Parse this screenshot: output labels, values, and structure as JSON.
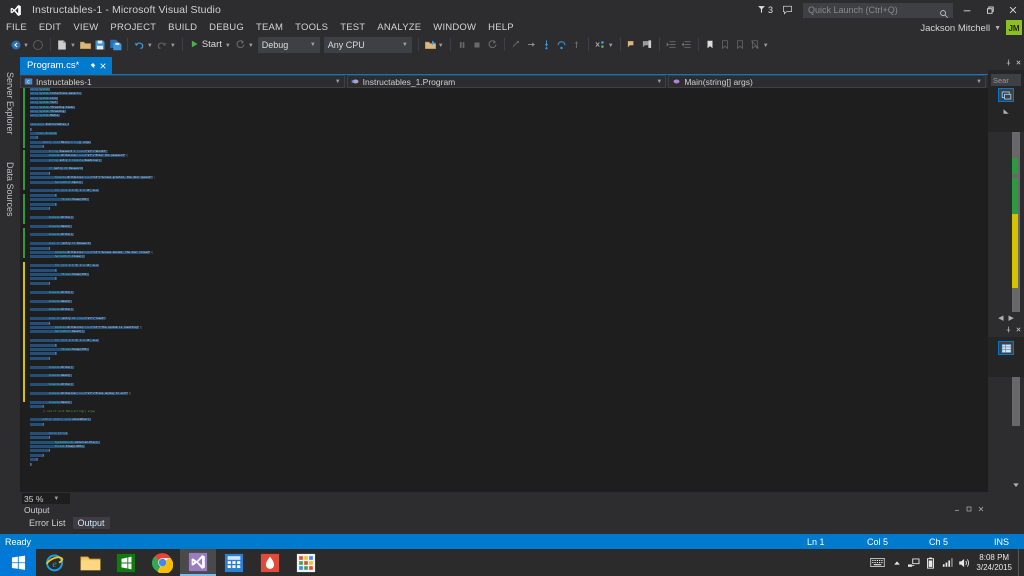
{
  "window": {
    "title": "Instructables-1 - Microsoft Visual Studio",
    "logo_icon": "visual-studio-logo",
    "minimize_icon": "minimize-icon",
    "restore_icon": "restore-icon",
    "close_icon": "close-icon"
  },
  "titlebar": {
    "notification_icon": "notification-flag-icon",
    "notification_count": "3",
    "feedback_icon": "feedback-smiley-icon",
    "quick_launch_placeholder": "Quick Launch (Ctrl+Q)",
    "quick_launch_value": "",
    "search_icon": "search-magnifier-icon"
  },
  "menu": {
    "items": [
      "FILE",
      "EDIT",
      "VIEW",
      "PROJECT",
      "BUILD",
      "DEBUG",
      "TEAM",
      "TOOLS",
      "TEST",
      "ANALYZE",
      "WINDOW",
      "HELP"
    ]
  },
  "account": {
    "user_name": "Jackson Mitchell",
    "avatar_initials": "JM",
    "caret_icon": "chevron-down-icon"
  },
  "toolbar": {
    "navigate_back_icon": "navigate-back-icon",
    "navigate_forward_icon": "navigate-forward-icon",
    "new_project_icon": "new-project-icon",
    "open_file_icon": "open-file-icon",
    "save_icon": "save-icon",
    "save_all_icon": "save-all-icon",
    "undo_icon": "undo-icon",
    "redo_icon": "redo-icon",
    "start_label": "Start",
    "start_icon": "start-play-icon",
    "restart_icon": "restart-icon",
    "configuration": "Debug",
    "platform": "Any CPU",
    "pause_icon": "pause-icon",
    "stop_icon": "stop-icon",
    "restart_debug_icon": "restart-debug-icon",
    "show_next_statement_icon": "show-next-statement-icon",
    "step_into_icon": "step-into-icon",
    "step_over_icon": "step-over-icon",
    "step_out_icon": "step-out-icon",
    "hex_icon": "hex-display-icon",
    "thread_icon": "thread-icon",
    "comment_icon": "comment-selection-icon",
    "uncomment_icon": "uncomment-selection-icon",
    "indent_icon": "increase-indent-icon",
    "outdent_icon": "decrease-indent-icon",
    "bookmark_icon": "bookmark-icon",
    "bookmark_prev_icon": "previous-bookmark-icon",
    "bookmark_next_icon": "next-bookmark-icon",
    "bookmark_clear_icon": "clear-bookmarks-icon",
    "overflow_icon": "toolbar-overflow-icon"
  },
  "left_dock": {
    "tabs": [
      "Server Explorer",
      "Data Sources"
    ]
  },
  "editor": {
    "tab_label": "Program.cs*",
    "tab_pin_icon": "pin-icon",
    "tab_close_icon": "close-icon",
    "project_scope": "Instructables-1",
    "project_icon": "csharp-project-icon",
    "type_scope": "Instructables_1.Program",
    "type_icon": "class-icon",
    "member_scope": "Main(string[] args)",
    "member_icon": "method-icon",
    "zoom_level": "35 %",
    "zoom_caret_icon": "chevron-down-icon",
    "scroll_up_icon": "scroll-up-arrow",
    "scroll_down_icon": "scroll-down-arrow",
    "split_icon": "split-view-icon"
  },
  "code": {
    "lines": [
      {
        "t": "using System;",
        "sel": true,
        "ind": 0
      },
      {
        "t": "using System.Collections.Generic;",
        "sel": true,
        "ind": 0
      },
      {
        "t": "using System.Linq;",
        "sel": true,
        "ind": 0
      },
      {
        "t": "using System.Text;",
        "sel": true,
        "ind": 0
      },
      {
        "t": "using System.Threading.Tasks;",
        "sel": true,
        "ind": 0
      },
      {
        "t": "using System.Threading;",
        "sel": true,
        "ind": 0
      },
      {
        "t": "using System.Media;",
        "sel": true,
        "ind": 0
      },
      {
        "t": "",
        "sel": false,
        "ind": 0
      },
      {
        "t": "namespace Instructables_1",
        "sel": true,
        "ind": 0
      },
      {
        "t": "{",
        "sel": true,
        "ind": 0
      },
      {
        "t": "class Program",
        "sel": true,
        "ind": 1
      },
      {
        "t": "{",
        "sel": true,
        "ind": 1
      },
      {
        "t": "static void Main(string[] args)",
        "sel": true,
        "ind": 2
      },
      {
        "t": "{",
        "sel": true,
        "ind": 2
      },
      {
        "t": "string Password = \"abc123\";",
        "sel": true,
        "ind": 3
      },
      {
        "t": "Console.WriteLine(\"Enter the password\");",
        "sel": true,
        "ind": 3
      },
      {
        "t": "string entry = Console.ReadLine();",
        "sel": true,
        "ind": 3
      },
      {
        "t": "",
        "sel": false,
        "ind": 0
      },
      {
        "t": "if (entry == Password)",
        "sel": true,
        "ind": 3
      },
      {
        "t": "{",
        "sel": true,
        "ind": 3
      },
      {
        "t": "Console.WriteLine(\"Access granted, the door opened\");",
        "sel": true,
        "ind": 4
      },
      {
        "t": "SerialPort.Open();",
        "sel": true,
        "ind": 4
      },
      {
        "t": "",
        "sel": false,
        "ind": 0
      },
      {
        "t": "for (int x = 0; x < 10; x++)",
        "sel": true,
        "ind": 4
      },
      {
        "t": "{",
        "sel": true,
        "ind": 4
      },
      {
        "t": "Thread.Sleep(500);",
        "sel": true,
        "ind": 5
      },
      {
        "t": "}",
        "sel": true,
        "ind": 4
      },
      {
        "t": "}",
        "sel": true,
        "ind": 3
      },
      {
        "t": "",
        "sel": false,
        "ind": 0
      },
      {
        "t": "Console.Write();",
        "sel": true,
        "ind": 3
      },
      {
        "t": "",
        "sel": false,
        "ind": 0
      },
      {
        "t": "Console.Read();",
        "sel": true,
        "ind": 3
      },
      {
        "t": "",
        "sel": false,
        "ind": 0
      },
      {
        "t": "Console.Write();",
        "sel": true,
        "ind": 3
      },
      {
        "t": "",
        "sel": false,
        "ind": 0
      },
      {
        "t": "else if (entry != Password)",
        "sel": true,
        "ind": 3
      },
      {
        "t": "{",
        "sel": true,
        "ind": 3
      },
      {
        "t": "Console.WriteLine(\"Access denied, the door closed\");",
        "sel": true,
        "ind": 4
      },
      {
        "t": "SerialPort.Close();",
        "sel": true,
        "ind": 4
      },
      {
        "t": "",
        "sel": false,
        "ind": 0
      },
      {
        "t": "for (int x = 0; x < 10; x++)",
        "sel": true,
        "ind": 4
      },
      {
        "t": "{",
        "sel": true,
        "ind": 4
      },
      {
        "t": "Thread.Sleep(500);",
        "sel": true,
        "ind": 5
      },
      {
        "t": "}",
        "sel": true,
        "ind": 4
      },
      {
        "t": "}",
        "sel": true,
        "ind": 3
      },
      {
        "t": "",
        "sel": false,
        "ind": 0
      },
      {
        "t": "Console.Write();",
        "sel": true,
        "ind": 3
      },
      {
        "t": "",
        "sel": false,
        "ind": 0
      },
      {
        "t": "Console.Read();",
        "sel": true,
        "ind": 3
      },
      {
        "t": "",
        "sel": false,
        "ind": 0
      },
      {
        "t": "Console.Write();",
        "sel": true,
        "ind": 3
      },
      {
        "t": "",
        "sel": false,
        "ind": 0
      },
      {
        "t": "else if (entry == \"reset\")",
        "sel": true,
        "ind": 3
      },
      {
        "t": "{",
        "sel": true,
        "ind": 3
      },
      {
        "t": "Console.WriteLine(\"The system is resetting\");",
        "sel": true,
        "ind": 4
      },
      {
        "t": "SerialPort.Reset();",
        "sel": true,
        "ind": 4
      },
      {
        "t": "",
        "sel": false,
        "ind": 0
      },
      {
        "t": "for (int x = 0; x < 10; x++)",
        "sel": true,
        "ind": 4
      },
      {
        "t": "{",
        "sel": true,
        "ind": 4
      },
      {
        "t": "Thread.Sleep(500);",
        "sel": true,
        "ind": 5
      },
      {
        "t": "}",
        "sel": true,
        "ind": 4
      },
      {
        "t": "}",
        "sel": true,
        "ind": 3
      },
      {
        "t": "",
        "sel": false,
        "ind": 0
      },
      {
        "t": "Console.Write();",
        "sel": true,
        "ind": 3
      },
      {
        "t": "",
        "sel": false,
        "ind": 0
      },
      {
        "t": "Console.Read();",
        "sel": true,
        "ind": 3
      },
      {
        "t": "",
        "sel": false,
        "ind": 0
      },
      {
        "t": "Console.Write();",
        "sel": true,
        "ind": 3
      },
      {
        "t": "",
        "sel": false,
        "ind": 0
      },
      {
        "t": "Console.WriteLine(\"Press anykey to exit\");",
        "sel": true,
        "ind": 3
      },
      {
        "t": "",
        "sel": false,
        "ind": 0
      },
      {
        "t": "Console.Read();",
        "sel": true,
        "ind": 3
      },
      {
        "t": "}",
        "sel": true,
        "ind": 2
      },
      {
        "t": "// end of void Main(string[] args)",
        "sel": false,
        "ind": 2
      },
      {
        "t": "",
        "sel": false,
        "ind": 0
      },
      {
        "t": "public static void unlockDoor()",
        "sel": true,
        "ind": 2
      },
      {
        "t": "{",
        "sel": true,
        "ind": 2
      },
      {
        "t": "",
        "sel": false,
        "ind": 0
      },
      {
        "t": "while (true)",
        "sel": true,
        "ind": 3
      },
      {
        "t": "{",
        "sel": true,
        "ind": 3
      },
      {
        "t": "SystemSounds.Asterisk.Play();",
        "sel": true,
        "ind": 4
      },
      {
        "t": "Thread.Sleep(1000);",
        "sel": true,
        "ind": 4
      },
      {
        "t": "}",
        "sel": true,
        "ind": 3
      },
      {
        "t": "}",
        "sel": true,
        "ind": 2
      },
      {
        "t": "}",
        "sel": true,
        "ind": 1
      },
      {
        "t": "}",
        "sel": true,
        "ind": 0
      }
    ]
  },
  "right_dock": {
    "solution_explorer": {
      "close_icon": "close-icon",
      "pin_icon": "pin-icon",
      "search_placeholder": "Sear",
      "view_icon": "solution-explorer-icon",
      "expand_icon": "expand-icon"
    },
    "properties": {
      "nav_left_icon": "nav-left-icon",
      "nav_right_icon": "nav-right-icon",
      "close_icon": "close-icon",
      "pin_icon": "pin-icon",
      "panel_icon": "properties-grid-icon"
    }
  },
  "bottom_panel": {
    "title": "Output",
    "tabs": [
      {
        "label": "Error List",
        "active": false
      },
      {
        "label": "Output",
        "active": true
      }
    ],
    "minimize_icon": "minimize-icon",
    "maximize_icon": "maximize-icon",
    "close_icon": "close-icon"
  },
  "status": {
    "message": "Ready",
    "line": "Ln 1",
    "column": "Col 5",
    "character": "Ch 5",
    "insert_mode": "INS"
  },
  "taskbar": {
    "start_icon": "windows-start-icon",
    "apps": [
      {
        "name": "internet-explorer-icon",
        "active": false
      },
      {
        "name": "file-explorer-icon",
        "active": false
      },
      {
        "name": "windows-store-icon",
        "active": false
      },
      {
        "name": "google-chrome-icon",
        "active": false
      },
      {
        "name": "visual-studio-icon",
        "active": true
      },
      {
        "name": "calculator-icon",
        "active": false
      },
      {
        "name": "red-app-icon",
        "active": false
      },
      {
        "name": "tiles-app-icon",
        "active": false
      }
    ],
    "tray": {
      "keyboard_icon": "touch-keyboard-icon",
      "show_hidden_icon": "show-hidden-icons-arrow",
      "network_icon": "network-icon",
      "battery_icon": "battery-icon",
      "signal_icon": "signal-strength-icon",
      "volume_icon": "volume-icon",
      "time": "8:08 PM",
      "date": "3/24/2015"
    }
  },
  "colors": {
    "accent": "#007acc",
    "chrome": "#2d2d30",
    "editor_bg": "#1e1e1e",
    "selection": "#264f78",
    "change_saved": "#2d9a3e",
    "change_unsaved": "#d6c200",
    "avatar": "#8cbf26"
  }
}
